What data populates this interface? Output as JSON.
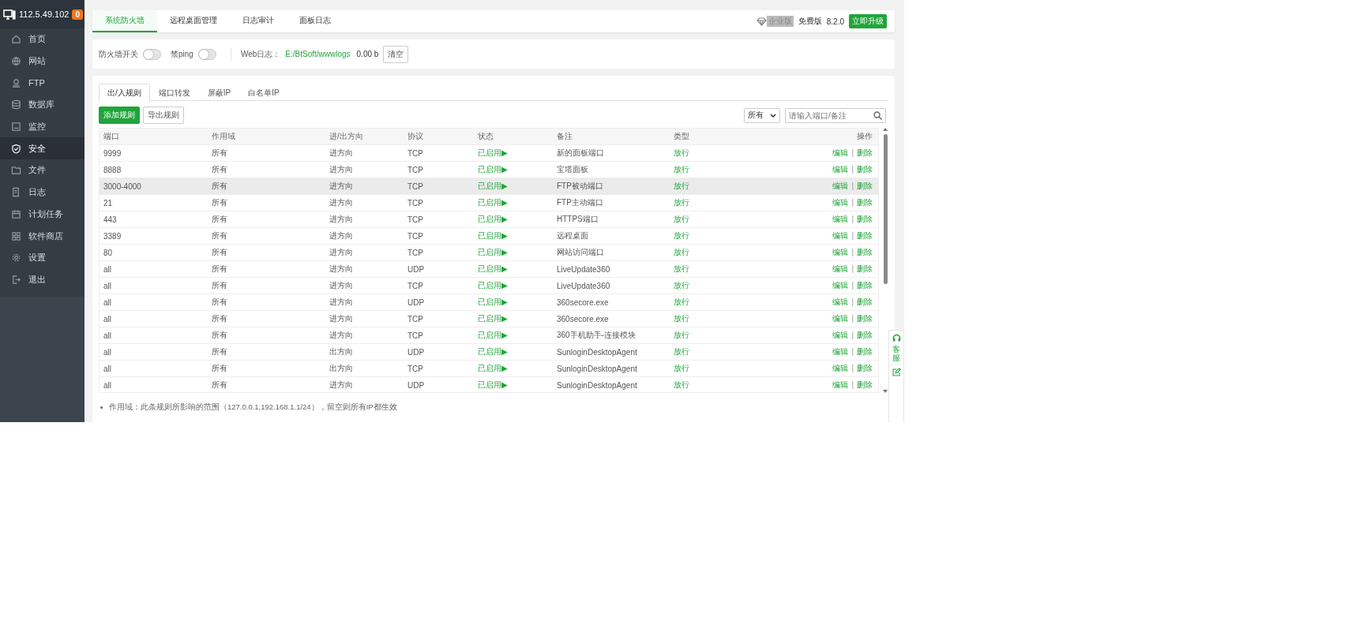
{
  "sidebar": {
    "server": "112.5.49.102",
    "badge": "0",
    "items": [
      {
        "label": "首页",
        "selected": false
      },
      {
        "label": "网站",
        "selected": false
      },
      {
        "label": "FTP",
        "selected": false
      },
      {
        "label": "数据库",
        "selected": false
      },
      {
        "label": "监控",
        "selected": false
      },
      {
        "label": "安全",
        "selected": true
      },
      {
        "label": "文件",
        "selected": false
      },
      {
        "label": "日志",
        "selected": false
      },
      {
        "label": "计划任务",
        "selected": false
      },
      {
        "label": "软件商店",
        "selected": false
      },
      {
        "label": "设置",
        "selected": false
      },
      {
        "label": "退出",
        "selected": false
      }
    ]
  },
  "top_tabs": [
    {
      "label": "系统防火墙",
      "selected": true
    },
    {
      "label": "远程桌面管理",
      "selected": false
    },
    {
      "label": "日志审计",
      "selected": false
    },
    {
      "label": "面板日志",
      "selected": false
    }
  ],
  "edition": {
    "enterprise": "企业版",
    "free": "免费版",
    "version": "8.2.0",
    "upgrade": "立即升级"
  },
  "settings": {
    "toggles": [
      {
        "label": "防火墙开关",
        "on": false
      },
      {
        "label": "禁ping",
        "on": false
      }
    ],
    "web_log_label": "Web日志：",
    "web_log_path": "E:/BtSoft/wwwlogs",
    "web_log_size": "0.00 b",
    "clear": "清空"
  },
  "sub_tabs": [
    {
      "label": "出/入规则",
      "selected": true
    },
    {
      "label": "端口转发",
      "selected": false
    },
    {
      "label": "屏蔽IP",
      "selected": false
    },
    {
      "label": "白名单IP",
      "selected": false
    }
  ],
  "toolbar": {
    "add": "添加规则",
    "export": "导出规则",
    "filter": "所有",
    "search_placeholder": "请输入端口/备注"
  },
  "table": {
    "columns": [
      "端口",
      "作用域",
      "进/出方向",
      "协议",
      "状态",
      "备注",
      "类型",
      "操作"
    ],
    "rows": [
      {
        "cells": [
          "9999",
          "所有",
          "进方向",
          "TCP",
          "已启用▶",
          "新的面板端口",
          "放行"
        ],
        "actions": [
          "编辑",
          "|",
          "删除"
        ],
        "hovered": false
      },
      {
        "cells": [
          "8888",
          "所有",
          "进方向",
          "TCP",
          "已启用▶",
          "宝塔面板",
          "放行"
        ],
        "actions": [
          "编辑",
          "|",
          "删除"
        ],
        "hovered": false
      },
      {
        "cells": [
          "3000-4000",
          "所有",
          "进方向",
          "TCP",
          "已启用▶",
          "FTP被动端口",
          "放行"
        ],
        "actions": [
          "编辑",
          "|",
          "删除"
        ],
        "hovered": true
      },
      {
        "cells": [
          "21",
          "所有",
          "进方向",
          "TCP",
          "已启用▶",
          "FTP主动端口",
          "放行"
        ],
        "actions": [
          "编辑",
          "|",
          "删除"
        ],
        "hovered": false
      },
      {
        "cells": [
          "443",
          "所有",
          "进方向",
          "TCP",
          "已启用▶",
          "HTTPS端口",
          "放行"
        ],
        "actions": [
          "编辑",
          "|",
          "删除"
        ],
        "hovered": false
      },
      {
        "cells": [
          "3389",
          "所有",
          "进方向",
          "TCP",
          "已启用▶",
          "远程桌面",
          "放行"
        ],
        "actions": [
          "编辑",
          "|",
          "删除"
        ],
        "hovered": false
      },
      {
        "cells": [
          "80",
          "所有",
          "进方向",
          "TCP",
          "已启用▶",
          "网站访问端口",
          "放行"
        ],
        "actions": [
          "编辑",
          "|",
          "删除"
        ],
        "hovered": false
      },
      {
        "cells": [
          "all",
          "所有",
          "进方向",
          "UDP",
          "已启用▶",
          "LiveUpdate360",
          "放行"
        ],
        "actions": [
          "编辑",
          "|",
          "删除"
        ],
        "hovered": false
      },
      {
        "cells": [
          "all",
          "所有",
          "进方向",
          "TCP",
          "已启用▶",
          "LiveUpdate360",
          "放行"
        ],
        "actions": [
          "编辑",
          "|",
          "删除"
        ],
        "hovered": false
      },
      {
        "cells": [
          "all",
          "所有",
          "进方向",
          "UDP",
          "已启用▶",
          "360secore.exe",
          "放行"
        ],
        "actions": [
          "编辑",
          "|",
          "删除"
        ],
        "hovered": false
      },
      {
        "cells": [
          "all",
          "所有",
          "进方向",
          "TCP",
          "已启用▶",
          "360secore.exe",
          "放行"
        ],
        "actions": [
          "编辑",
          "|",
          "删除"
        ],
        "hovered": false
      },
      {
        "cells": [
          "all",
          "所有",
          "进方向",
          "TCP",
          "已启用▶",
          "360手机助手-连接模块",
          "放行"
        ],
        "actions": [
          "编辑",
          "|",
          "删除"
        ],
        "hovered": false
      },
      {
        "cells": [
          "all",
          "所有",
          "出方向",
          "UDP",
          "已启用▶",
          "SunloginDesktopAgent",
          "放行"
        ],
        "actions": [
          "编辑",
          "|",
          "删除"
        ],
        "hovered": false
      },
      {
        "cells": [
          "all",
          "所有",
          "出方向",
          "TCP",
          "已启用▶",
          "SunloginDesktopAgent",
          "放行"
        ],
        "actions": [
          "编辑",
          "|",
          "删除"
        ],
        "hovered": false
      },
      {
        "cells": [
          "all",
          "所有",
          "进方向",
          "UDP",
          "已启用▶",
          "SunloginDesktopAgent",
          "放行"
        ],
        "actions": [
          "编辑",
          "|",
          "删除"
        ],
        "hovered": false
      }
    ]
  },
  "note": "作用域：此条规则所影响的范围（127.0.0.1,192.168.1.1/24），留空则所有IP都生效",
  "support": "客服"
}
